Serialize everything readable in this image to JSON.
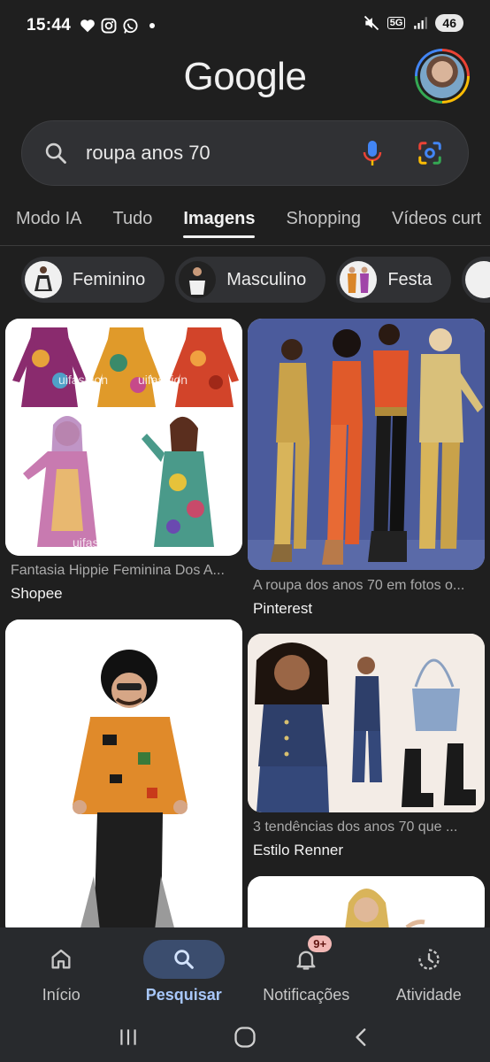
{
  "status_bar": {
    "time": "15:44",
    "network": "5G",
    "battery": "46"
  },
  "header": {
    "logo": "Google"
  },
  "search": {
    "query": "roupa anos 70"
  },
  "tabs": [
    {
      "label": "Modo IA",
      "active": false
    },
    {
      "label": "Tudo",
      "active": false
    },
    {
      "label": "Imagens",
      "active": true
    },
    {
      "label": "Shopping",
      "active": false
    },
    {
      "label": "Vídeos curt",
      "active": false
    }
  ],
  "chips": [
    {
      "label": "Feminino"
    },
    {
      "label": "Masculino"
    },
    {
      "label": "Festa"
    }
  ],
  "results": [
    {
      "caption": "Fantasia Hippie Feminina Dos A...",
      "source": "Shopee",
      "watermark": "uifashion"
    },
    {
      "caption": "A roupa dos anos 70 em fotos o...",
      "source": "Pinterest"
    },
    {
      "caption": "3 tendências dos anos 70 que ...",
      "source": "Estilo Renner"
    }
  ],
  "bottom_nav": {
    "items": [
      {
        "label": "Início",
        "icon": "home-icon"
      },
      {
        "label": "Pesquisar",
        "icon": "search-icon",
        "active": true
      },
      {
        "label": "Notificações",
        "icon": "bell-icon",
        "badge": "9+"
      },
      {
        "label": "Atividade",
        "icon": "history-icon"
      }
    ]
  },
  "colors": {
    "background": "#1f1f1f",
    "active_nav": "#a8c7fa",
    "badge": "#f2b8b5"
  }
}
